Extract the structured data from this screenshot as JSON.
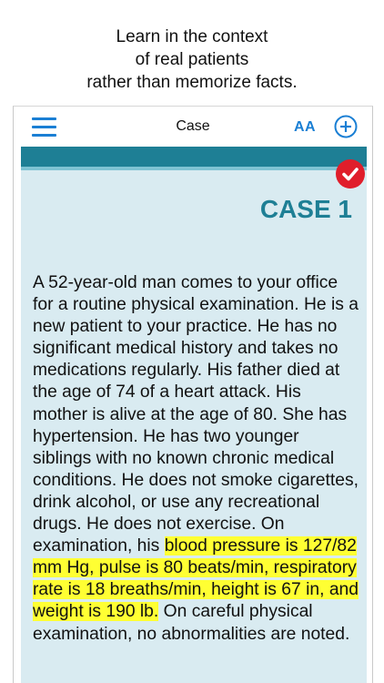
{
  "promo": {
    "line1": "Learn in the context",
    "line2": "of real patients",
    "line3": "rather than memorize facts."
  },
  "navbar": {
    "title": "Case",
    "font_size_label": "AA",
    "menu_icon": "hamburger-menu-icon",
    "add_icon": "plus-circle-icon"
  },
  "case": {
    "title": "CASE 1",
    "completed_icon": "checkmark-badge-icon",
    "text_before": "A 52-year-old man comes to your office for a routine physical examination. He is a new patient to your practice. He has no significant medical history and takes no medications regularly. His father died at the age of 74 of a heart attack. His mother is alive at the age of 80. She has hypertension. He has two younger siblings with no known chronic medical conditions. He does not smoke cigarettes, drink alcohol, or use any recreational drugs. He does not exercise. On examination, his ",
    "text_highlighted": "blood pressure is 127/82 mm Hg, pulse is 80 beats/min, respiratory rate is 18 breaths/min, height is 67 in, and weight is 190 lb.",
    "text_after": " On careful physical examination, no abnormalities are noted."
  },
  "colors": {
    "accent_blue": "#1a7fd4",
    "header_teal": "#1e7f95",
    "content_bg": "#d9ebf1",
    "badge_red": "#e01e2b",
    "highlight_yellow": "#ffff33"
  }
}
